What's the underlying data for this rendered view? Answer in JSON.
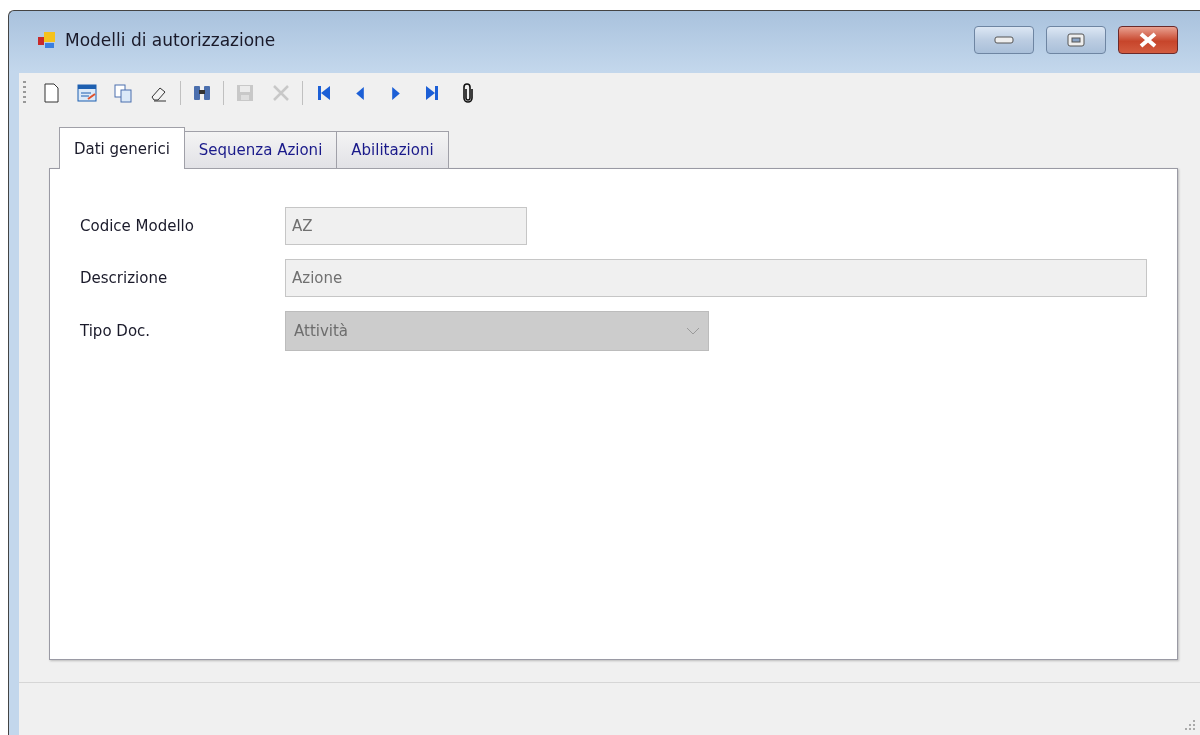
{
  "window": {
    "title": "Modelli di autorizzazione"
  },
  "toolbar": [
    {
      "kind": "new",
      "disabled": false
    },
    {
      "kind": "edit",
      "disabled": false
    },
    {
      "kind": "copy",
      "disabled": false
    },
    {
      "kind": "eraser",
      "disabled": false
    },
    {
      "kind": "separator"
    },
    {
      "kind": "find",
      "disabled": false
    },
    {
      "kind": "separator"
    },
    {
      "kind": "save",
      "disabled": true
    },
    {
      "kind": "delete",
      "disabled": true
    },
    {
      "kind": "separator"
    },
    {
      "kind": "first",
      "disabled": false
    },
    {
      "kind": "previous",
      "disabled": false
    },
    {
      "kind": "next",
      "disabled": false
    },
    {
      "kind": "last",
      "disabled": false
    },
    {
      "kind": "attach",
      "disabled": false
    }
  ],
  "tabs": [
    {
      "label": "Dati generici",
      "selected": true
    },
    {
      "label": "Sequenza Azioni",
      "selected": false
    },
    {
      "label": "Abilitazioni",
      "selected": false
    }
  ],
  "fields": [
    {
      "label": "Codice Modello",
      "kind": "text",
      "value": "AZ",
      "disabled": true
    },
    {
      "label": "Descrizione",
      "kind": "text",
      "value": "Azione",
      "disabled": true
    },
    {
      "label": "Tipo Doc.",
      "kind": "combo",
      "value": "Attività",
      "disabled": true
    }
  ]
}
